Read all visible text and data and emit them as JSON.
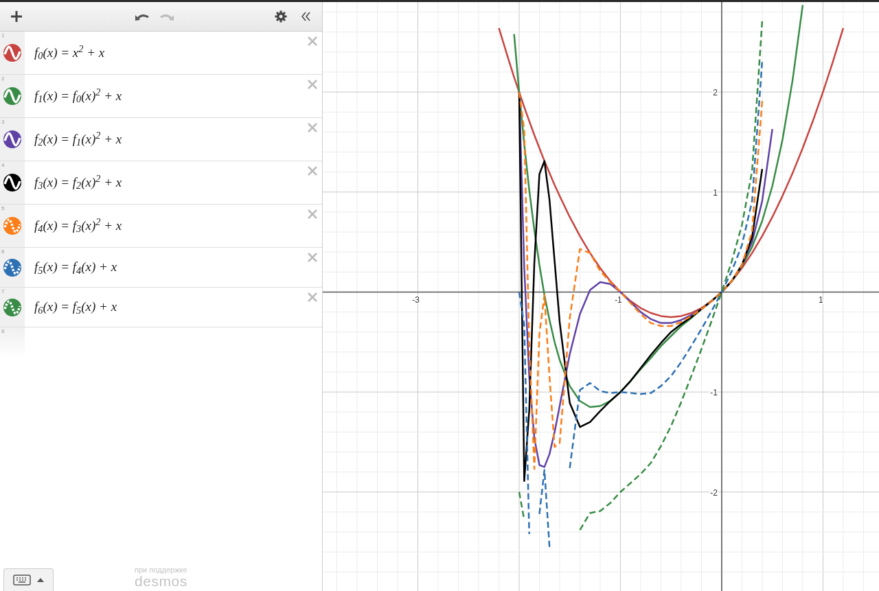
{
  "toolbar": {
    "undo": {
      "disabled": false
    },
    "redo": {
      "disabled": true
    }
  },
  "expressions": [
    {
      "index": "1",
      "formula": "f$_{0}$(x) = x$^{2}$ + x",
      "color": "#c74440",
      "dashed": false
    },
    {
      "index": "2",
      "formula": "f$_{1}$(x) = f$_{0}$(x)$^{2}$ + x",
      "color": "#388c46",
      "dashed": false
    },
    {
      "index": "3",
      "formula": "f$_{2}$(x) = f$_{1}$(x)$^{2}$ + x",
      "color": "#6042a6",
      "dashed": false
    },
    {
      "index": "4",
      "formula": "f$_{3}$(x) = f$_{2}$(x)$^{2}$ + x",
      "color": "#000000",
      "dashed": false
    },
    {
      "index": "5",
      "formula": "f$_{4}$(x) = f$_{3}$(x)$^{2}$ + x",
      "color": "#fa7e19",
      "dashed": true
    },
    {
      "index": "6",
      "formula": "f$_{5}$(x) = f$_{4}$(x) + x",
      "color": "#2d70b3",
      "dashed": true
    },
    {
      "index": "7",
      "formula": "f$_{6}$(x) = f$_{5}$(x) + x",
      "color": "#388c46",
      "dashed": true
    }
  ],
  "empty_row": {
    "index": "8"
  },
  "footer": {
    "powered_by": "при поддержке",
    "brand": "desmos"
  },
  "graph": {
    "chart_data": {
      "type": "line",
      "grid": true,
      "xlim": [
        -3.939,
        1.553
      ],
      "ylim": [
        -2.99,
        2.9
      ],
      "xticks": [
        -3,
        -1,
        1
      ],
      "yticks": [
        2,
        1,
        -1,
        -2
      ],
      "x": [
        -2.2,
        -2.1,
        -2.05,
        -2,
        -1.95,
        -1.9,
        -1.85,
        -1.8,
        -1.75,
        -1.7,
        -1.65,
        -1.6,
        -1.5,
        -1.4,
        -1.3,
        -1.2,
        -1.1,
        -1,
        -0.9,
        -0.8,
        -0.7,
        -0.6,
        -0.5,
        -0.4,
        -0.3,
        -0.2,
        -0.1,
        0,
        0.1,
        0.2,
        0.3,
        0.4,
        0.5,
        0.6,
        0.7,
        0.8,
        0.9,
        1,
        1.1,
        1.2
      ],
      "series": [
        {
          "color": "#c74440",
          "line_style": "solid",
          "values": [
            2.64,
            2.31,
            2.15,
            2,
            1.85,
            1.71,
            1.57,
            1.44,
            1.31,
            1.19,
            1.07,
            0.96,
            0.75,
            0.56,
            0.39,
            0.24,
            0.11,
            0,
            -0.09,
            -0.16,
            -0.21,
            -0.24,
            -0.25,
            -0.24,
            -0.21,
            -0.16,
            -0.09,
            0,
            0.11,
            0.24,
            0.39,
            0.56,
            0.75,
            0.96,
            1.19,
            1.44,
            1.71,
            2,
            2.31,
            2.64
          ]
        },
        {
          "color": "#388c46",
          "line_style": "solid",
          "values": [
            null,
            null,
            2.58,
            2,
            1.48,
            1.02,
            0.62,
            0.27,
            -0.03,
            -0.28,
            -0.5,
            -0.68,
            -0.94,
            -1.09,
            -1.15,
            -1.14,
            -1.09,
            -1,
            -0.89,
            -0.77,
            -0.66,
            -0.54,
            -0.44,
            -0.34,
            -0.26,
            -0.17,
            -0.09,
            0,
            0.11,
            0.26,
            0.45,
            0.71,
            1.06,
            1.52,
            2.12,
            2.87,
            null,
            null,
            null,
            null
          ]
        },
        {
          "color": "#6042a6",
          "line_style": "solid",
          "values": [
            null,
            null,
            null,
            2,
            0.25,
            -0.85,
            -1.46,
            -1.73,
            -1.75,
            -1.62,
            -1.4,
            -1.14,
            -0.62,
            -0.22,
            0.02,
            0.1,
            0.08,
            0,
            -0.1,
            -0.2,
            -0.27,
            -0.31,
            -0.31,
            -0.28,
            -0.23,
            -0.17,
            -0.09,
            0,
            0.11,
            0.27,
            0.5,
            0.91,
            1.63,
            null,
            null,
            null,
            null,
            null,
            null,
            null
          ]
        },
        {
          "color": "#000000",
          "line_style": "solid",
          "values": [
            null,
            null,
            null,
            2,
            -1.89,
            -1.18,
            0.29,
            1.18,
            1.31,
            0.92,
            0.31,
            -0.3,
            -1.11,
            -1.35,
            -1.3,
            -1.19,
            -1.09,
            -1,
            -0.89,
            -0.76,
            -0.63,
            -0.51,
            -0.4,
            -0.32,
            -0.25,
            -0.17,
            -0.09,
            0,
            0.11,
            0.27,
            0.55,
            1.23,
            null,
            null,
            null,
            null,
            null,
            null,
            null,
            null
          ]
        },
        {
          "color": "#fa7e19",
          "line_style": "dashed",
          "values": [
            null,
            null,
            null,
            2,
            1.62,
            -0.52,
            -1.77,
            -0.42,
            -0.03,
            -0.85,
            -1.55,
            -1.51,
            -0.26,
            0.43,
            0.39,
            0.21,
            0.1,
            0,
            -0.11,
            -0.22,
            -0.31,
            -0.34,
            -0.34,
            -0.3,
            -0.24,
            -0.17,
            -0.09,
            0,
            0.11,
            0.27,
            0.61,
            1.91,
            null,
            null,
            null,
            null,
            null,
            null,
            null,
            null
          ]
        },
        {
          "color": "#2d70b3",
          "line_style": "dashed",
          "values": [
            null,
            null,
            null,
            0,
            -0.33,
            -2.42,
            null,
            -2.22,
            -1.78,
            -2.55,
            null,
            null,
            -1.76,
            -0.98,
            -0.91,
            -0.99,
            -1.01,
            -1,
            -1.01,
            -1.02,
            -1.01,
            -0.94,
            -0.84,
            -0.7,
            -0.54,
            -0.37,
            -0.19,
            0,
            0.21,
            0.47,
            0.91,
            2.31,
            null,
            null,
            null,
            null,
            null,
            null,
            null,
            null
          ]
        },
        {
          "color": "#388c46",
          "line_style": "dashed",
          "values": [
            null,
            null,
            null,
            -2,
            -2.28,
            null,
            null,
            null,
            null,
            null,
            null,
            null,
            null,
            -2.38,
            -2.21,
            -2.19,
            -2.11,
            -2,
            -1.91,
            -1.82,
            -1.71,
            -1.54,
            -1.34,
            -1.1,
            -0.84,
            -0.57,
            -0.29,
            0,
            0.31,
            0.67,
            1.21,
            2.71,
            null,
            null,
            null,
            null,
            null,
            null,
            null,
            null
          ]
        }
      ]
    }
  }
}
